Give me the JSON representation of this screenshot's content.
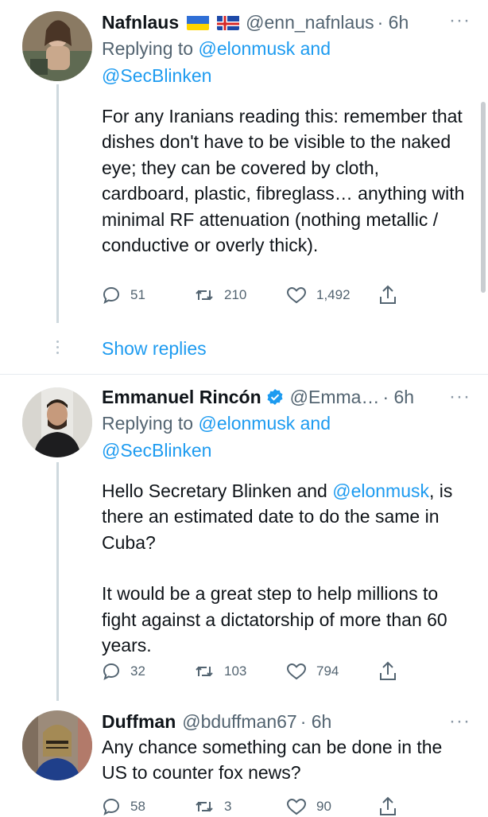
{
  "colors": {
    "accent": "#1d9bf0",
    "muted": "#536471",
    "text": "#0f1419",
    "thread_line": "#cfd9de"
  },
  "tweets": [
    {
      "name": "Nafnlaus",
      "flags": [
        "ukraine-flag-icon",
        "iceland-flag-icon"
      ],
      "handle": "@enn_nafnlaus",
      "time": "· 6h",
      "replying_prefix": "Replying to",
      "replying_to_1": "@elonmusk and",
      "replying_to_2": "@SecBlinken",
      "text": "For any Iranians reading this: remember that dishes don't have to be visible to the naked eye; they can be covered by cloth, cardboard, plastic, fibreglass… anything with minimal RF attenuation (nothing metallic / conductive or overly thick).",
      "replies": "51",
      "retweets": "210",
      "likes": "1,492"
    },
    {
      "name": "Emmanuel Rincón",
      "verified": true,
      "handle": "@Emma…",
      "time": "· 6h",
      "replying_prefix": "Replying to",
      "replying_to_1": "@elonmusk and",
      "replying_to_2": "@SecBlinken",
      "text_part1": "Hello Secretary Blinken and ",
      "text_mention": "@elonmusk",
      "text_part2": ", is there an estimated date to do the same in Cuba?",
      "text_para2": "It would be a great step to help millions to fight against a dictatorship of more than 60 years.",
      "replies": "32",
      "retweets": "103",
      "likes": "794"
    },
    {
      "name": "Duffman",
      "handle": "@bduffman67",
      "time": "· 6h",
      "text": "Any chance something can be done in the US to counter fox news?",
      "replies": "58",
      "retweets": "3",
      "likes": "90"
    }
  ],
  "show_replies": "Show replies",
  "more_glyph": "···"
}
